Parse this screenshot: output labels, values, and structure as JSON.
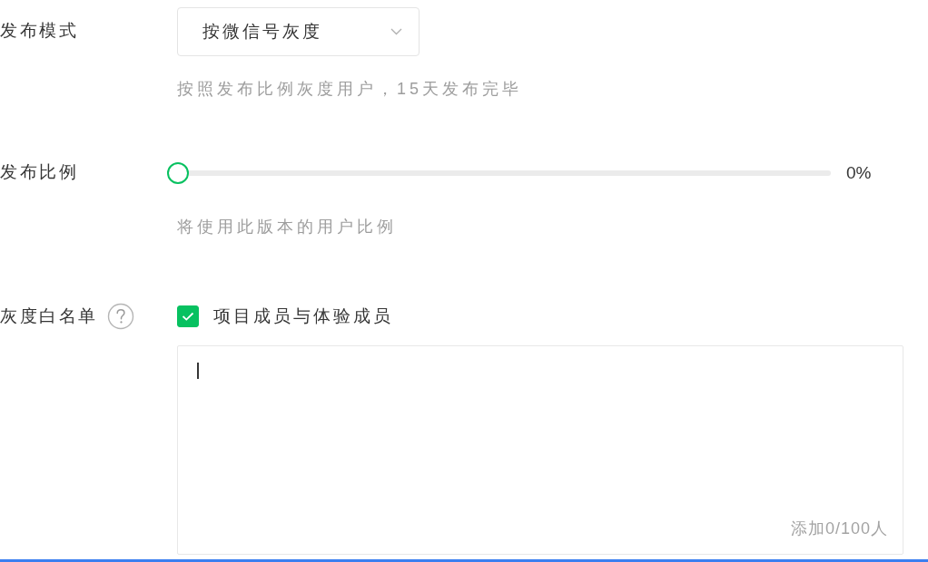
{
  "fields": [
    {
      "kind": "select",
      "label": "发布模式",
      "value": "按微信号灰度",
      "hint": "按照发布比例灰度用户，15天发布完毕"
    },
    {
      "kind": "slider",
      "label": "发布比例",
      "level": 0,
      "reading": "0%",
      "hint": "将使用此版本的用户比例"
    },
    {
      "kind": "whitelist",
      "label": "灰度白名单",
      "help": true,
      "checkbox": {
        "label": "项目成员与体验成员",
        "checked": true
      },
      "textarea": {
        "focused": true,
        "counter": "添加0/100人"
      }
    }
  ]
}
